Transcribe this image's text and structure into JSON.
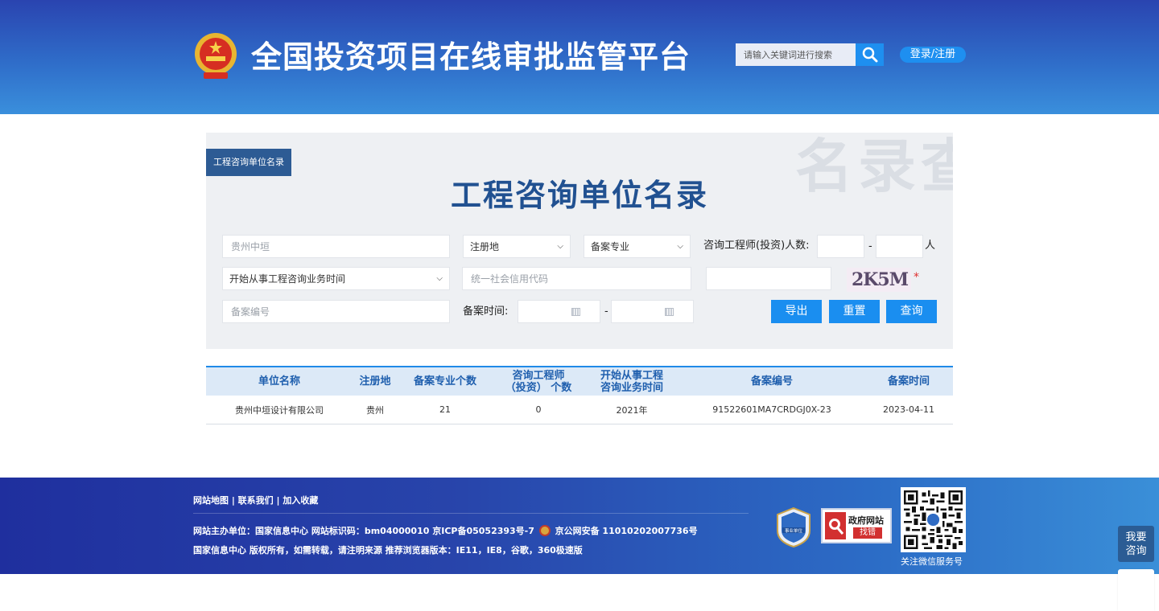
{
  "header": {
    "site_title": "全国投资项目在线审批监管平台",
    "search_placeholder": "请输入关键词进行搜索",
    "login_label": "登录/注册"
  },
  "panel": {
    "tab_label": "工程咨询单位名录",
    "heading": "工程咨询单位名录",
    "watermark": "名录查询",
    "fields": {
      "company_name_placeholder": "贵州中垣",
      "region_select": "注册地",
      "specialty_select": "备案专业",
      "engineer_count_label": "咨询工程师(投资)人数:",
      "range_dash": "-",
      "people_unit": "人",
      "start_time_select": "开始从事工程咨询业务时间",
      "credit_code_placeholder": "统一社会信用代码",
      "record_no_placeholder": "备案编号",
      "record_time_label": "备案时间:",
      "date_dash": "-",
      "captcha_text": "2K5M",
      "required_mark": "*"
    },
    "buttons": {
      "export": "导出",
      "reset": "重置",
      "query": "查询"
    }
  },
  "results": {
    "columns": [
      "单位名称",
      "注册地",
      "备案专业个数",
      "咨询工程师\n（投资） 个数",
      "开始从事工程\n咨询业务时间",
      "备案编号",
      "备案时间"
    ],
    "rows": [
      [
        "贵州中垣设计有限公司",
        "贵州",
        "21",
        "0",
        "2021年",
        "91522601MA7CRDGJ0X-23",
        "2023-04-11"
      ]
    ]
  },
  "footer": {
    "links": "网站地图 | 联系我们 | 加入收藏",
    "line1_a": "网站主办单位：国家信息中心    网站标识码：bm04000010    京ICP备05052393号-7",
    "line1_b": "京公网安备 11010202007736号",
    "line2": "国家信息中心 版权所有，如需转载，请注明来源    推荐浏览器版本：IE11，IE8，谷歌，360极速版",
    "shield_text": "事业单位",
    "gov_find_title": "政府网站",
    "gov_find_sub": "找错",
    "qr_caption": "关注微信服务号"
  },
  "float": {
    "ask_label": "我要咨询"
  }
}
